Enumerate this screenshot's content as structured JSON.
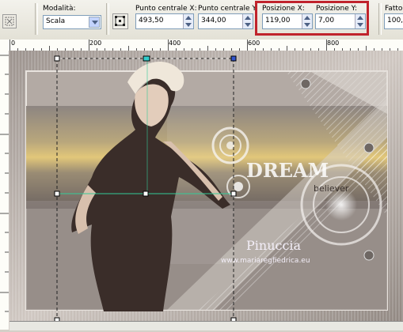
{
  "toolbar": {
    "mode_label": "Modalità:",
    "mode_value": "Scala",
    "center_x_label": "Punto centrale X:",
    "center_x_value": "493,50",
    "center_y_label": "Punto centrale Y:",
    "center_y_value": "344,00",
    "pos_x_label": "Posizione X:",
    "pos_x_value": "119,00",
    "pos_y_label": "Posizione Y:",
    "pos_y_value": "7,00",
    "factor_label": "Fattor",
    "factor_value": "100,0"
  },
  "ruler": {
    "numbers": [
      "0",
      "200",
      "400",
      "600",
      "800"
    ]
  },
  "canvas": {
    "logo_main": "DREAM",
    "logo_sub": "believer",
    "signature": "Pinuccia",
    "website": "www.mariaregfiedrica.eu"
  },
  "colors": {
    "highlight": "#c0232c",
    "toolbar_bg": "#ebe9e0",
    "canvas_bg": "#b7aea8"
  },
  "icons": [
    "deform-tool-icon",
    "center-pick-icon",
    "dropdown-arrow-icon",
    "spin-arrows-icon"
  ]
}
